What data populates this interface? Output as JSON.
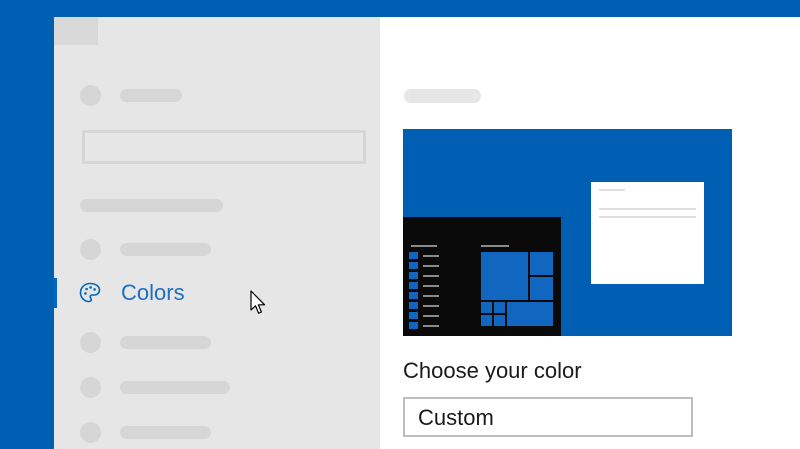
{
  "sidebar": {
    "selected_item": {
      "label": "Colors",
      "icon": "palette-icon"
    }
  },
  "content": {
    "section_label": "Choose your color",
    "color_dropdown": {
      "selected_value": "Custom"
    }
  },
  "colors": {
    "accent": "#0067c0",
    "desktop_background": "#005fb2",
    "sidebar_background": "#e6e6e6"
  }
}
